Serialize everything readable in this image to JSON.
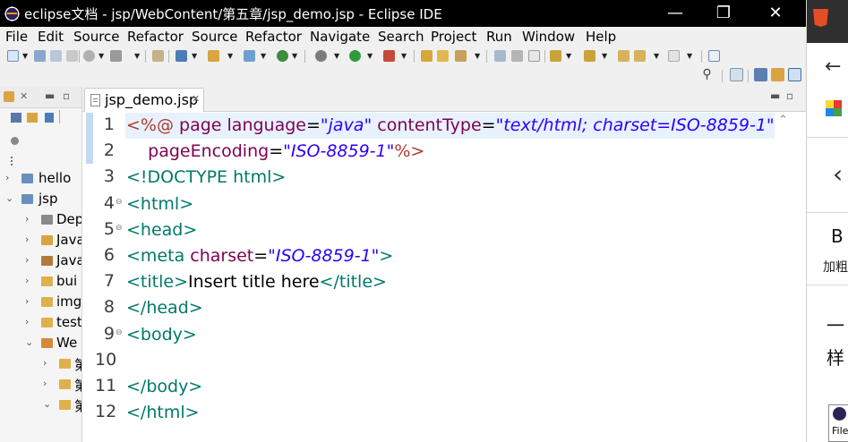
{
  "window": {
    "title": "eclipse文档 - jsp/WebContent/第五章/jsp_demo.jsp - Eclipse IDE",
    "minimize": "—",
    "maximize": "❐",
    "close": "✕"
  },
  "menu": [
    "File",
    "Edit",
    "Source",
    "Refactor",
    "Source",
    "Refactor",
    "Navigate",
    "Search",
    "Project",
    "Run",
    "Window",
    "Help"
  ],
  "explorer": {
    "tree": [
      {
        "label": "hello",
        "icon": "project-icon",
        "twisty": "›"
      },
      {
        "label": "jsp",
        "icon": "web-project-icon",
        "twisty": "⌄"
      },
      {
        "label": "Dep",
        "icon": "deployment-icon",
        "twisty": "›"
      },
      {
        "label": "Java",
        "icon": "java-resources-icon",
        "twisty": "›"
      },
      {
        "label": "Java",
        "icon": "library-icon",
        "twisty": "›"
      },
      {
        "label": "bui",
        "icon": "folder-icon",
        "twisty": "›"
      },
      {
        "label": "img",
        "icon": "folder-icon",
        "twisty": "›"
      },
      {
        "label": "test",
        "icon": "folder-icon",
        "twisty": "›"
      },
      {
        "label": "We",
        "icon": "webcontent-folder-icon",
        "twisty": "⌄"
      },
      {
        "label": "第",
        "icon": "folder-icon",
        "twisty": "›"
      },
      {
        "label": "第",
        "icon": "folder-icon",
        "twisty": "›"
      },
      {
        "label": "第",
        "icon": "folder-icon",
        "twisty": "⌄"
      }
    ]
  },
  "editor": {
    "tab_label": "jsp_demo.jsp",
    "tab_close": "✕",
    "lines": [
      {
        "num": "1",
        "segments": [
          [
            "kw-jsp",
            "<%@ "
          ],
          [
            "kw-attr",
            "page "
          ],
          [
            "kw-attr",
            "language"
          ],
          [
            "txt",
            "="
          ],
          [
            "str",
            "\"java\""
          ],
          [
            "txt",
            " "
          ],
          [
            "kw-attr",
            "contentType"
          ],
          [
            "txt",
            "="
          ],
          [
            "str",
            "\"text/html; charset=ISO-8859-1\""
          ]
        ]
      },
      {
        "num": "2",
        "segments": [
          [
            "txt",
            "    "
          ],
          [
            "kw-attr",
            "pageEncoding"
          ],
          [
            "txt",
            "="
          ],
          [
            "str",
            "\"ISO-8859-1\""
          ],
          [
            "kw-jsp",
            "%>"
          ]
        ]
      },
      {
        "num": "3",
        "segments": [
          [
            "tag",
            "<!DOCTYPE html>"
          ]
        ]
      },
      {
        "num": "4",
        "fold": true,
        "segments": [
          [
            "tag",
            "<html>"
          ]
        ]
      },
      {
        "num": "5",
        "fold": true,
        "segments": [
          [
            "tag",
            "<head>"
          ]
        ]
      },
      {
        "num": "6",
        "segments": [
          [
            "tag",
            "<meta "
          ],
          [
            "kw-attr",
            "charset"
          ],
          [
            "txt",
            "="
          ],
          [
            "str",
            "\"ISO-8859-1\""
          ],
          [
            "tag",
            ">"
          ]
        ]
      },
      {
        "num": "7",
        "segments": [
          [
            "tag",
            "<title>"
          ],
          [
            "txt",
            "Insert title here"
          ],
          [
            "tag",
            "</title>"
          ]
        ]
      },
      {
        "num": "8",
        "segments": [
          [
            "tag",
            "</head>"
          ]
        ]
      },
      {
        "num": "9",
        "fold": true,
        "segments": [
          [
            "tag",
            "<body>"
          ]
        ]
      },
      {
        "num": "10",
        "segments": []
      },
      {
        "num": "11",
        "segments": [
          [
            "tag",
            "</body>"
          ]
        ]
      },
      {
        "num": "12",
        "segments": [
          [
            "tag",
            "</html>"
          ]
        ]
      }
    ]
  },
  "background_window": {
    "text_b": "B",
    "text_bold_label": "加粗",
    "text_dash": "一",
    "text_yang": "样",
    "thumb_label": "File"
  },
  "colors": {
    "jsp_directive": "#b03a2e",
    "attribute": "#7f0055",
    "string": "#2a00ff",
    "tag": "#00796b",
    "current_line": "#e8f2fe"
  }
}
